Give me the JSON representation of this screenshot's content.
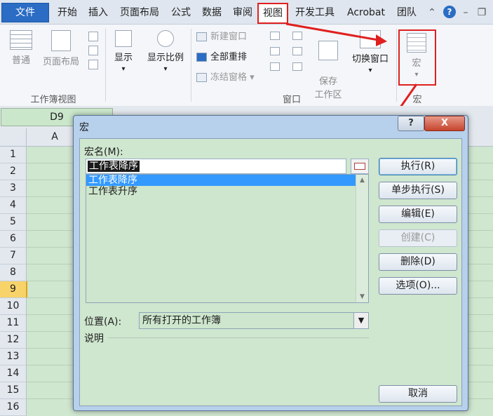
{
  "ribbon_tabs": [
    "文件",
    "开始",
    "插入",
    "页面布局",
    "公式",
    "数据",
    "审阅",
    "视图",
    "开发工具",
    "Acrobat",
    "团队"
  ],
  "workbook_views": {
    "normal": "普通",
    "page_layout": "页面布局",
    "group": "工作簿视图"
  },
  "show_label": "显示",
  "zoom_label": "显示比例",
  "window_group": {
    "new_window": "新建窗口",
    "arrange_all": "全部重排",
    "freeze_panes": "冻结窗格",
    "save_workspace": "保存\n工作区",
    "switch_window": "切换窗口",
    "group": "窗口"
  },
  "macro_group": {
    "macro": "宏",
    "group": "宏"
  },
  "name_box": "D9",
  "column_label": "A",
  "rows": [
    "1",
    "2",
    "3",
    "4",
    "5",
    "6",
    "7",
    "8",
    "9",
    "10",
    "11",
    "12",
    "13",
    "14",
    "15",
    "16"
  ],
  "selected_row": "9",
  "dialog": {
    "title": "宏",
    "help": "?",
    "close": "X",
    "macro_name_label": "宏名(M):",
    "macro_name_value": "工作表降序",
    "macros": [
      "工作表降序",
      "工作表升序"
    ],
    "buttons": {
      "run": "执行(R)",
      "step_into": "单步执行(S)",
      "edit": "编辑(E)",
      "create": "创建(C)",
      "delete": "删除(D)",
      "options": "选项(O)..."
    },
    "location_label": "位置(A):",
    "location_value": "所有打开的工作簿",
    "description_label": "说明",
    "cancel": "取消"
  },
  "colors": {
    "highlight": "#e02020",
    "selection": "#3399ff",
    "grid_bg": "#cfe6cf",
    "file_tab": "#2b6cc4"
  }
}
